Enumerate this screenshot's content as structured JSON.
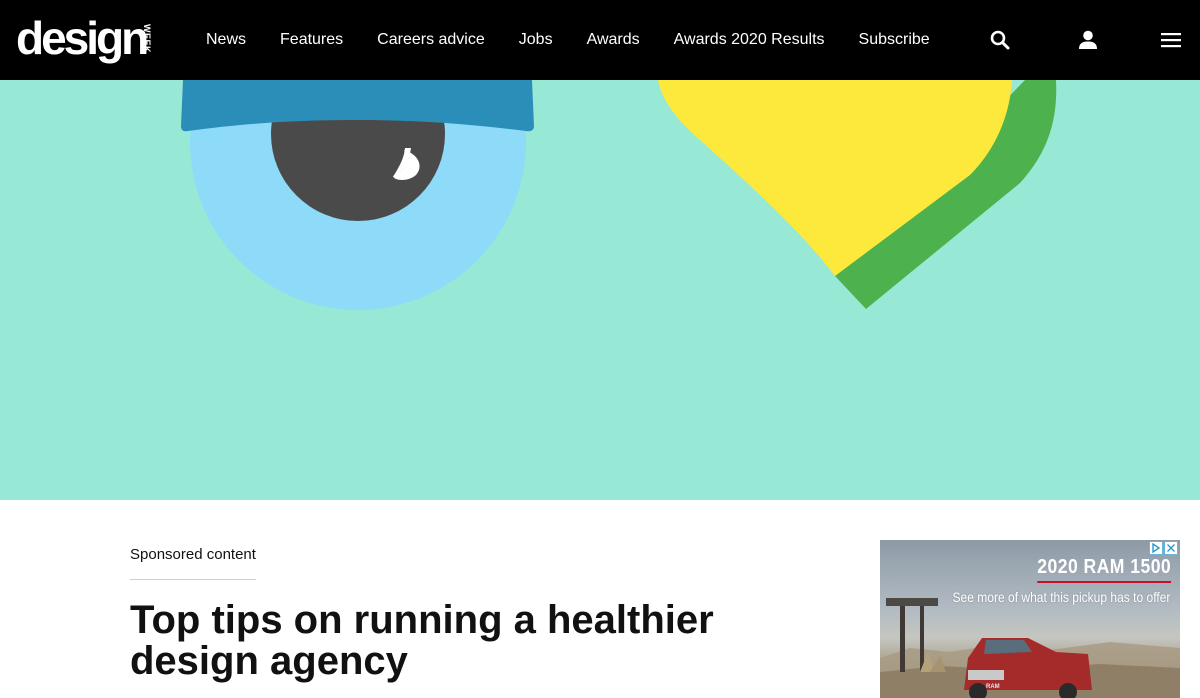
{
  "header": {
    "logo_text": "design",
    "logo_side_text": "WEEK",
    "nav": [
      {
        "label": "News"
      },
      {
        "label": "Features"
      },
      {
        "label": "Careers advice"
      },
      {
        "label": "Jobs"
      },
      {
        "label": "Awards"
      },
      {
        "label": "Awards 2020 Results"
      },
      {
        "label": "Subscribe"
      }
    ],
    "icons": [
      "search-icon",
      "user-icon",
      "menu-icon"
    ]
  },
  "hero": {
    "background_color": "#98e8d6",
    "illustration": [
      "eye-icon",
      "heart-icon"
    ],
    "colors": {
      "eye_cap": "#2b8eb8",
      "eye_iris": "#8ddbf8",
      "eye_pupil": "#4a4a4a",
      "heart_yellow": "#fde93b",
      "heart_green": "#4db24e"
    }
  },
  "article": {
    "kicker": "Sponsored content",
    "headline": "Top tips on running a healthier design agency"
  },
  "ad": {
    "title": "2020 RAM 1500",
    "subtitle": "See more of what this pickup has to offer",
    "badge": "RAM",
    "accent_color": "#c8102e",
    "icons": [
      "ad-choices-icon",
      "close-icon"
    ]
  }
}
